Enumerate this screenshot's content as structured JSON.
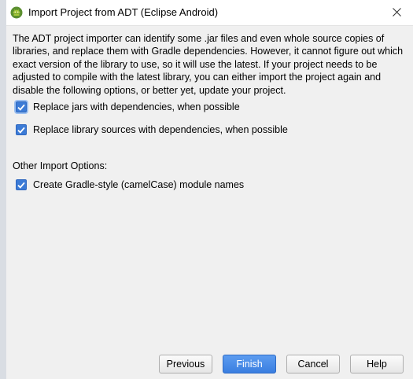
{
  "window": {
    "title": "Import Project from ADT (Eclipse Android)",
    "icons": {
      "app": "android-icon",
      "close": "close-icon"
    }
  },
  "description": "The ADT project importer can identify some .jar files and even whole source copies of libraries, and replace them with Gradle dependencies. However, it cannot figure out which exact version of the library to use, so it will use the latest. If your project needs to be adjusted to compile with the latest library, you can either import the project again and disable the following options, or better yet, update your project.",
  "options": {
    "replace_jars": {
      "label": "Replace jars with dependencies, when possible",
      "checked": true
    },
    "replace_sources": {
      "label": "Replace library sources with dependencies, when possible",
      "checked": true
    }
  },
  "other_options": {
    "heading": "Other Import Options:",
    "camelcase": {
      "label": "Create Gradle-style (camelCase) module names",
      "checked": true
    }
  },
  "buttons": {
    "previous": "Previous",
    "finish": "Finish",
    "cancel": "Cancel",
    "help": "Help"
  },
  "colors": {
    "accent": "#3c7bd6",
    "primary_button": "#4a8ce8",
    "dialog_bg": "#f0f0f0"
  }
}
